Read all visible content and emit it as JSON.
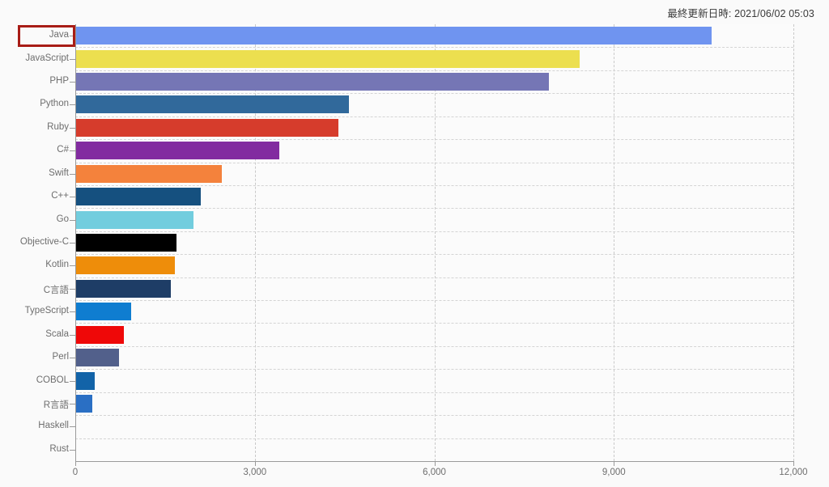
{
  "header": {
    "last_updated_label": "最終更新日時: 2021/06/02 05:03"
  },
  "highlight": {
    "target_label": "Java",
    "color": "#a81c16"
  },
  "axis": {
    "x_ticks": [
      "0",
      "3,000",
      "6,000",
      "9,000",
      "12,000"
    ],
    "x_min": 0,
    "x_max": 12000
  },
  "chart_data": {
    "type": "bar",
    "orientation": "horizontal",
    "title": "",
    "subtitle": "",
    "xlabel": "",
    "ylabel": "",
    "xlim": [
      0,
      12000
    ],
    "grid": true,
    "legend": false,
    "tick_labels_x": [
      "0",
      "3,000",
      "6,000",
      "9,000",
      "12,000"
    ],
    "categories": [
      "Java",
      "JavaScript",
      "PHP",
      "Python",
      "Ruby",
      "C#",
      "Swift",
      "C++",
      "Go",
      "Objective-C",
      "Kotlin",
      "C言語",
      "TypeScript",
      "Scala",
      "Perl",
      "COBOL",
      "R言語",
      "Haskell",
      "Rust"
    ],
    "values": [
      10620,
      8410,
      7900,
      4560,
      4380,
      3400,
      2440,
      2090,
      1960,
      1680,
      1650,
      1580,
      920,
      800,
      720,
      310,
      270,
      0,
      0
    ],
    "colors": [
      "#6f94f0",
      "#ecdf4f",
      "#7576b5",
      "#31699b",
      "#d63c2c",
      "#822ba0",
      "#f4823c",
      "#15507f",
      "#72cdde",
      "#000000",
      "#ee8d0a",
      "#1e3d66",
      "#0f7dd0",
      "#ef0808",
      "#52608b",
      "#1263a8",
      "#2a6fc4",
      "#2a6fc4",
      "#2a6fc4"
    ]
  }
}
